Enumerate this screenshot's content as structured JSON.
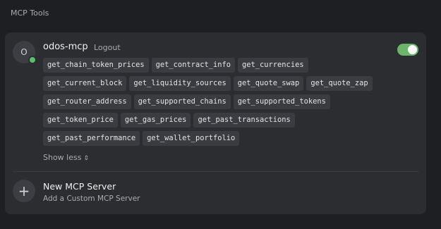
{
  "section": {
    "title": "MCP Tools"
  },
  "server": {
    "avatar_letter": "O",
    "name": "odos-mcp",
    "logout_label": "Logout",
    "enabled": true,
    "tools": [
      "get_chain_token_prices",
      "get_contract_info",
      "get_currencies",
      "get_current_block",
      "get_liquidity_sources",
      "get_quote_swap",
      "get_quote_zap",
      "get_router_address",
      "get_supported_chains",
      "get_supported_tokens",
      "get_token_price",
      "get_gas_prices",
      "get_past_transactions",
      "get_past_performance",
      "get_wallet_portfolio"
    ],
    "show_less_label": "Show less",
    "show_less_icon": "chevron-up-down-icon"
  },
  "new_server": {
    "icon": "plus-icon",
    "title": "New MCP Server",
    "subtitle": "Add a Custom MCP Server"
  },
  "colors": {
    "background": "#1e1f22",
    "card": "#2b2d31",
    "chip": "#3a3c41",
    "toggle_on": "#6ab56a",
    "status_online": "#5bbf6a"
  }
}
